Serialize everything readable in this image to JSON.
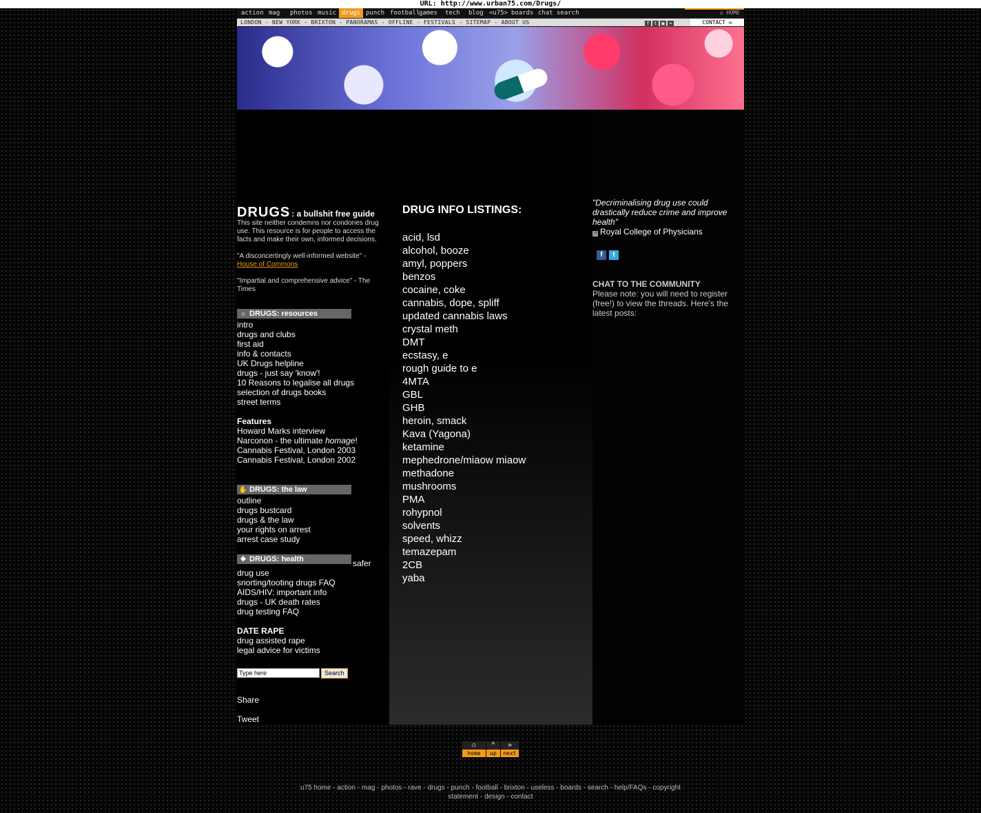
{
  "url_bar": "URL: http://www.urban75.com/Drugs/",
  "nav_main": [
    "action",
    "mag",
    "photos",
    "music",
    "drugs",
    "punch",
    "football",
    "games",
    "tech",
    "blog",
    "<u75>",
    "boards",
    "chat",
    "search"
  ],
  "nav_active": "drugs",
  "nav_home": "⌂ HOME",
  "nav_sub": "LONDON - NEW YORK - BRIXTON - PANORAMAS - OFFLINE - FESTIVALS - SITEMAP - ABOUT US",
  "nav_icons": [
    "f",
    "t",
    "▦",
    "≈"
  ],
  "contact_label": "CONTACT ✉",
  "left": {
    "logo": "DRUGS",
    "logo_tag": ": a bullshit free guide",
    "intro_text": "This site neither condemns nor condones drug use. This resource is for people to access the facts and make their own, informed decisions.",
    "quote1": "\"A disconcertingly well-informed website\" -",
    "quote1_link": "House of Commons",
    "quote2": "\"Impartial and comprehensive advice\" - The Times",
    "resources_header": "DRUGS: resources",
    "resources_glyph": "☼",
    "resources": [
      "intro",
      "drugs and clubs",
      "first aid",
      "info & contacts",
      "UK Drugs helpline",
      "drugs - just say 'know'!",
      "10 Reasons to legalise all drugs",
      "selection of drugs books",
      "street terms"
    ],
    "features_title": "Features",
    "features": [
      "Howard Marks interview",
      "Cannabis Festival, London 2003",
      "Cannabis Festival, London 2002"
    ],
    "narconon_pre": "Narconon - the ultimate ",
    "narconon_em": "homage",
    "narconon_post": "!",
    "law_header": "DRUGS: the law",
    "law_glyph": "✋",
    "law": [
      "outline",
      "drugs bustcard",
      "drugs & the law",
      "your rights on arrest",
      "arrest case study"
    ],
    "health_header": "DRUGS: health",
    "health_glyph": "❖",
    "health_safer": "safer",
    "health": [
      "drug use",
      "snorting/tooting drugs FAQ",
      "AIDS/HIV: important info",
      "drugs - UK death rates",
      "drug testing FAQ"
    ],
    "daterape_title": "DATE RAPE",
    "daterape": [
      "drug assisted rape",
      "legal advice for victims"
    ],
    "search_placeholder": "Type here",
    "search_button": "Search",
    "share": "Share",
    "tweet": "Tweet"
  },
  "listings_title": "DRUG INFO LISTINGS:",
  "listings": [
    "acid, lsd",
    "alcohol, booze",
    "amyl, poppers",
    "benzos",
    "cocaine, coke",
    "cannabis, dope, spliff",
    "updated cannabis laws",
    "crystal meth",
    "DMT",
    "ecstasy, e",
    "rough guide to e",
    "4MTA",
    "GBL",
    "GHB",
    "heroin, smack",
    "Kava (Yagona)",
    "ketamine",
    "mephedrone/miaow miaow",
    "methadone",
    "mushrooms",
    "PMA",
    "rohypnol",
    "solvents",
    "speed, whizz",
    "temazepam",
    "2CB",
    "yaba"
  ],
  "right": {
    "quote": "\"Decriminalising drug use could drastically reduce crime and improve health\"",
    "quote_source": "Royal College of Physicians",
    "social": [
      "f",
      "t"
    ],
    "chat_title": "CHAT TO THE COMMUNITY",
    "chat_note": "Please note: you will need to register (free!) to view the threads. Here's the latest posts:"
  },
  "footnav": [
    {
      "sym": "⌂",
      "label": "home"
    },
    {
      "sym": "^",
      "label": "up"
    },
    {
      "sym": "»",
      "label": "next"
    }
  ],
  "footer_line1": "u75 home - action - mag - photos - rave - drugs - punch - football - brixton - useless - boards - search - help/FAQs - copyright",
  "footer_line2": "statement - design - contact",
  "colors": {
    "accent": "#f39a1e",
    "bar": "#666666",
    "bg": "#060606"
  }
}
